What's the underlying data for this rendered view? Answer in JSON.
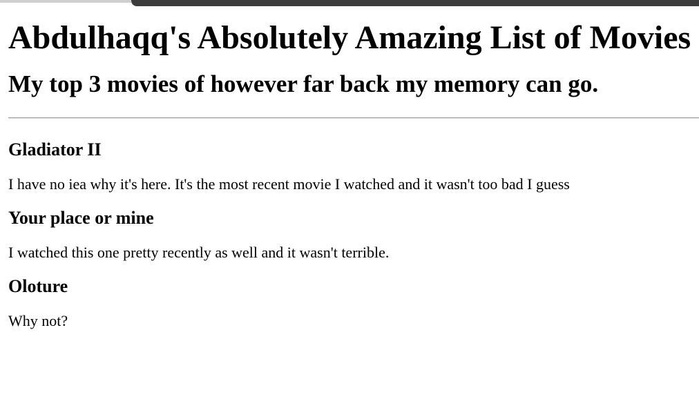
{
  "page": {
    "title": "Abdulhaqq's Absolutely Amazing List of Movies",
    "subtitle": "My top 3 movies of however far back my memory can go."
  },
  "movies": [
    {
      "title": "Gladiator II",
      "description": "I have no iea why it's here. It's the most recent movie I watched and it wasn't too bad I guess"
    },
    {
      "title": "Your place or mine",
      "description": "I watched this one pretty recently as well and it wasn't terrible."
    },
    {
      "title": "Oloture",
      "description": "Why not?"
    }
  ]
}
